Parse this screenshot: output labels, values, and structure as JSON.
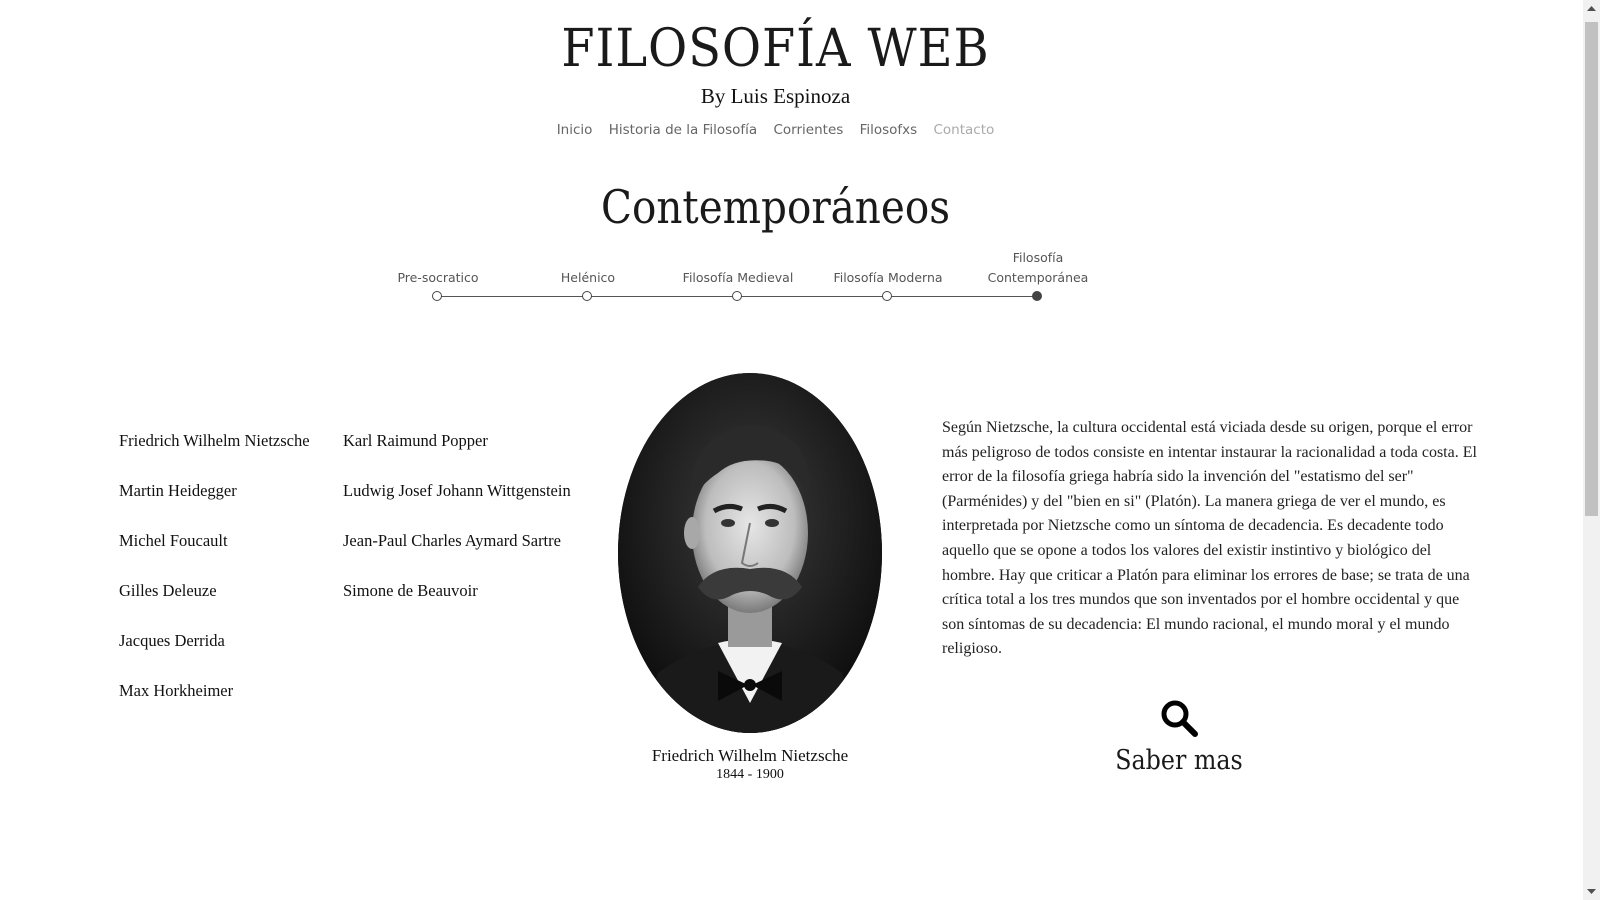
{
  "header": {
    "title": "FILOSOFÍA WEB",
    "subtitle": "By Luis Espinoza"
  },
  "nav": {
    "items": [
      {
        "label": "Inicio"
      },
      {
        "label": "Historia de la Filosofía"
      },
      {
        "label": "Corrientes"
      },
      {
        "label": "Filosofxs"
      },
      {
        "label": "Contacto"
      }
    ]
  },
  "section": {
    "title": "Contemporáneos"
  },
  "timeline": {
    "items": [
      {
        "label": "Pre-socratico",
        "active": false
      },
      {
        "label": "Helénico",
        "active": false
      },
      {
        "label": "Filosofía Medieval",
        "active": false
      },
      {
        "label": "Filosofía Moderna",
        "active": false
      },
      {
        "label_line1": "Filosofía",
        "label_line2": "Contemporánea",
        "active": true
      }
    ]
  },
  "philosophers": {
    "column1": [
      "Friedrich Wilhelm Nietzsche",
      "Martin Heidegger",
      "Michel Foucault",
      "Gilles Deleuze",
      "Jacques Derrida",
      "Max Horkheimer"
    ],
    "column2": [
      "Karl Raimund Popper",
      "Ludwig Josef Johann Wittgenstein",
      "Jean-Paul Charles Aymard Sartre",
      "Simone de Beauvoir"
    ]
  },
  "featured": {
    "name": "Friedrich Wilhelm Nietzsche",
    "years": "1844 - 1900",
    "description": "Según Nietzsche, la cultura occidental está viciada desde su origen, porque el error más peligroso de todos consiste en intentar instaurar la racionalidad a toda costa. El error de la filosofía griega habría sido la invención del \"estatismo del ser\" (Parménides) y del \"bien en si\" (Platón). La manera griega de ver el mundo, es interpretada por Nietzsche como un síntoma de decadencia. Es decadente todo aquello que se opone a todos los valores del existir instintivo y biológico del hombre. Hay que criticar a Platón para eliminar los errores de base; se trata de una crítica total a los tres mundos que son inventados por el hombre occidental y que son síntomas de su decadencia: El mundo racional, el mundo moral y el mundo religioso.",
    "more_label": "Saber mas",
    "more_icon": "search-icon"
  },
  "colors": {
    "text": "#111111",
    "nav": "#666666",
    "nav_muted": "#aaaaaa",
    "timeline": "#444444"
  }
}
